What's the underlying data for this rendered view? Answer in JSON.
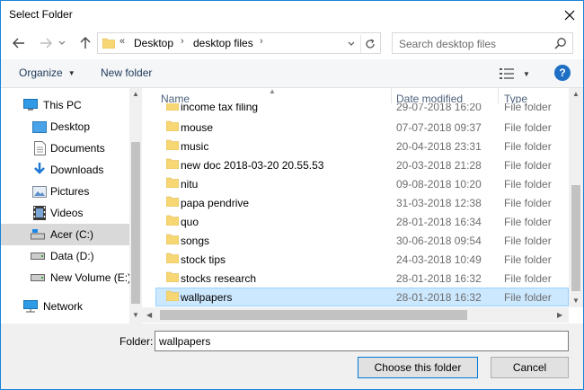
{
  "window": {
    "title": "Select Folder"
  },
  "address": {
    "overflow": "«",
    "crumbs": [
      "Desktop",
      "desktop files"
    ]
  },
  "search": {
    "placeholder": "Search desktop files"
  },
  "toolbar": {
    "organize": "Organize",
    "new_folder": "New folder",
    "help": "?"
  },
  "nav": {
    "items": [
      {
        "label": "This PC",
        "icon": "pc-icon"
      },
      {
        "label": "Desktop",
        "icon": "desktop-folder-icon"
      },
      {
        "label": "Documents",
        "icon": "documents-icon"
      },
      {
        "label": "Downloads",
        "icon": "downloads-icon"
      },
      {
        "label": "Pictures",
        "icon": "pictures-icon"
      },
      {
        "label": "Videos",
        "icon": "videos-icon"
      },
      {
        "label": "Acer (C:)",
        "icon": "drive-icon",
        "selected": true
      },
      {
        "label": "Data (D:)",
        "icon": "drive-icon"
      },
      {
        "label": "New Volume (E:)",
        "icon": "drive-icon"
      },
      {
        "label": "Network",
        "icon": "network-icon"
      }
    ]
  },
  "list": {
    "columns": {
      "name": "Name",
      "date": "Date modified",
      "type": "Type"
    },
    "partial_row": {
      "name": "income tax filing",
      "date": "29-07-2018 16:20",
      "type": "File folder"
    },
    "rows": [
      {
        "name": "mouse",
        "date": "07-07-2018 09:37",
        "type": "File folder"
      },
      {
        "name": "music",
        "date": "20-04-2018 23:31",
        "type": "File folder"
      },
      {
        "name": "new doc 2018-03-20 20.55.53",
        "date": "20-03-2018 21:28",
        "type": "File folder"
      },
      {
        "name": "nitu",
        "date": "09-08-2018 10:20",
        "type": "File folder"
      },
      {
        "name": "papa pendrive",
        "date": "31-03-2018 12:38",
        "type": "File folder"
      },
      {
        "name": "quo",
        "date": "28-01-2018 16:34",
        "type": "File folder"
      },
      {
        "name": "songs",
        "date": "30-06-2018 09:54",
        "type": "File folder"
      },
      {
        "name": "stock tips",
        "date": "24-03-2018 10:49",
        "type": "File folder"
      },
      {
        "name": "stocks research",
        "date": "28-01-2018 16:32",
        "type": "File folder"
      },
      {
        "name": "wallpapers",
        "date": "28-01-2018 16:32",
        "type": "File folder",
        "selected": true
      }
    ]
  },
  "footer": {
    "folder_label": "Folder:",
    "folder_value": "wallpapers",
    "ok": "Choose this folder",
    "cancel": "Cancel"
  },
  "colors": {
    "accent": "#0078d7",
    "selection": "#cce8ff",
    "folder": "#f7d774"
  }
}
